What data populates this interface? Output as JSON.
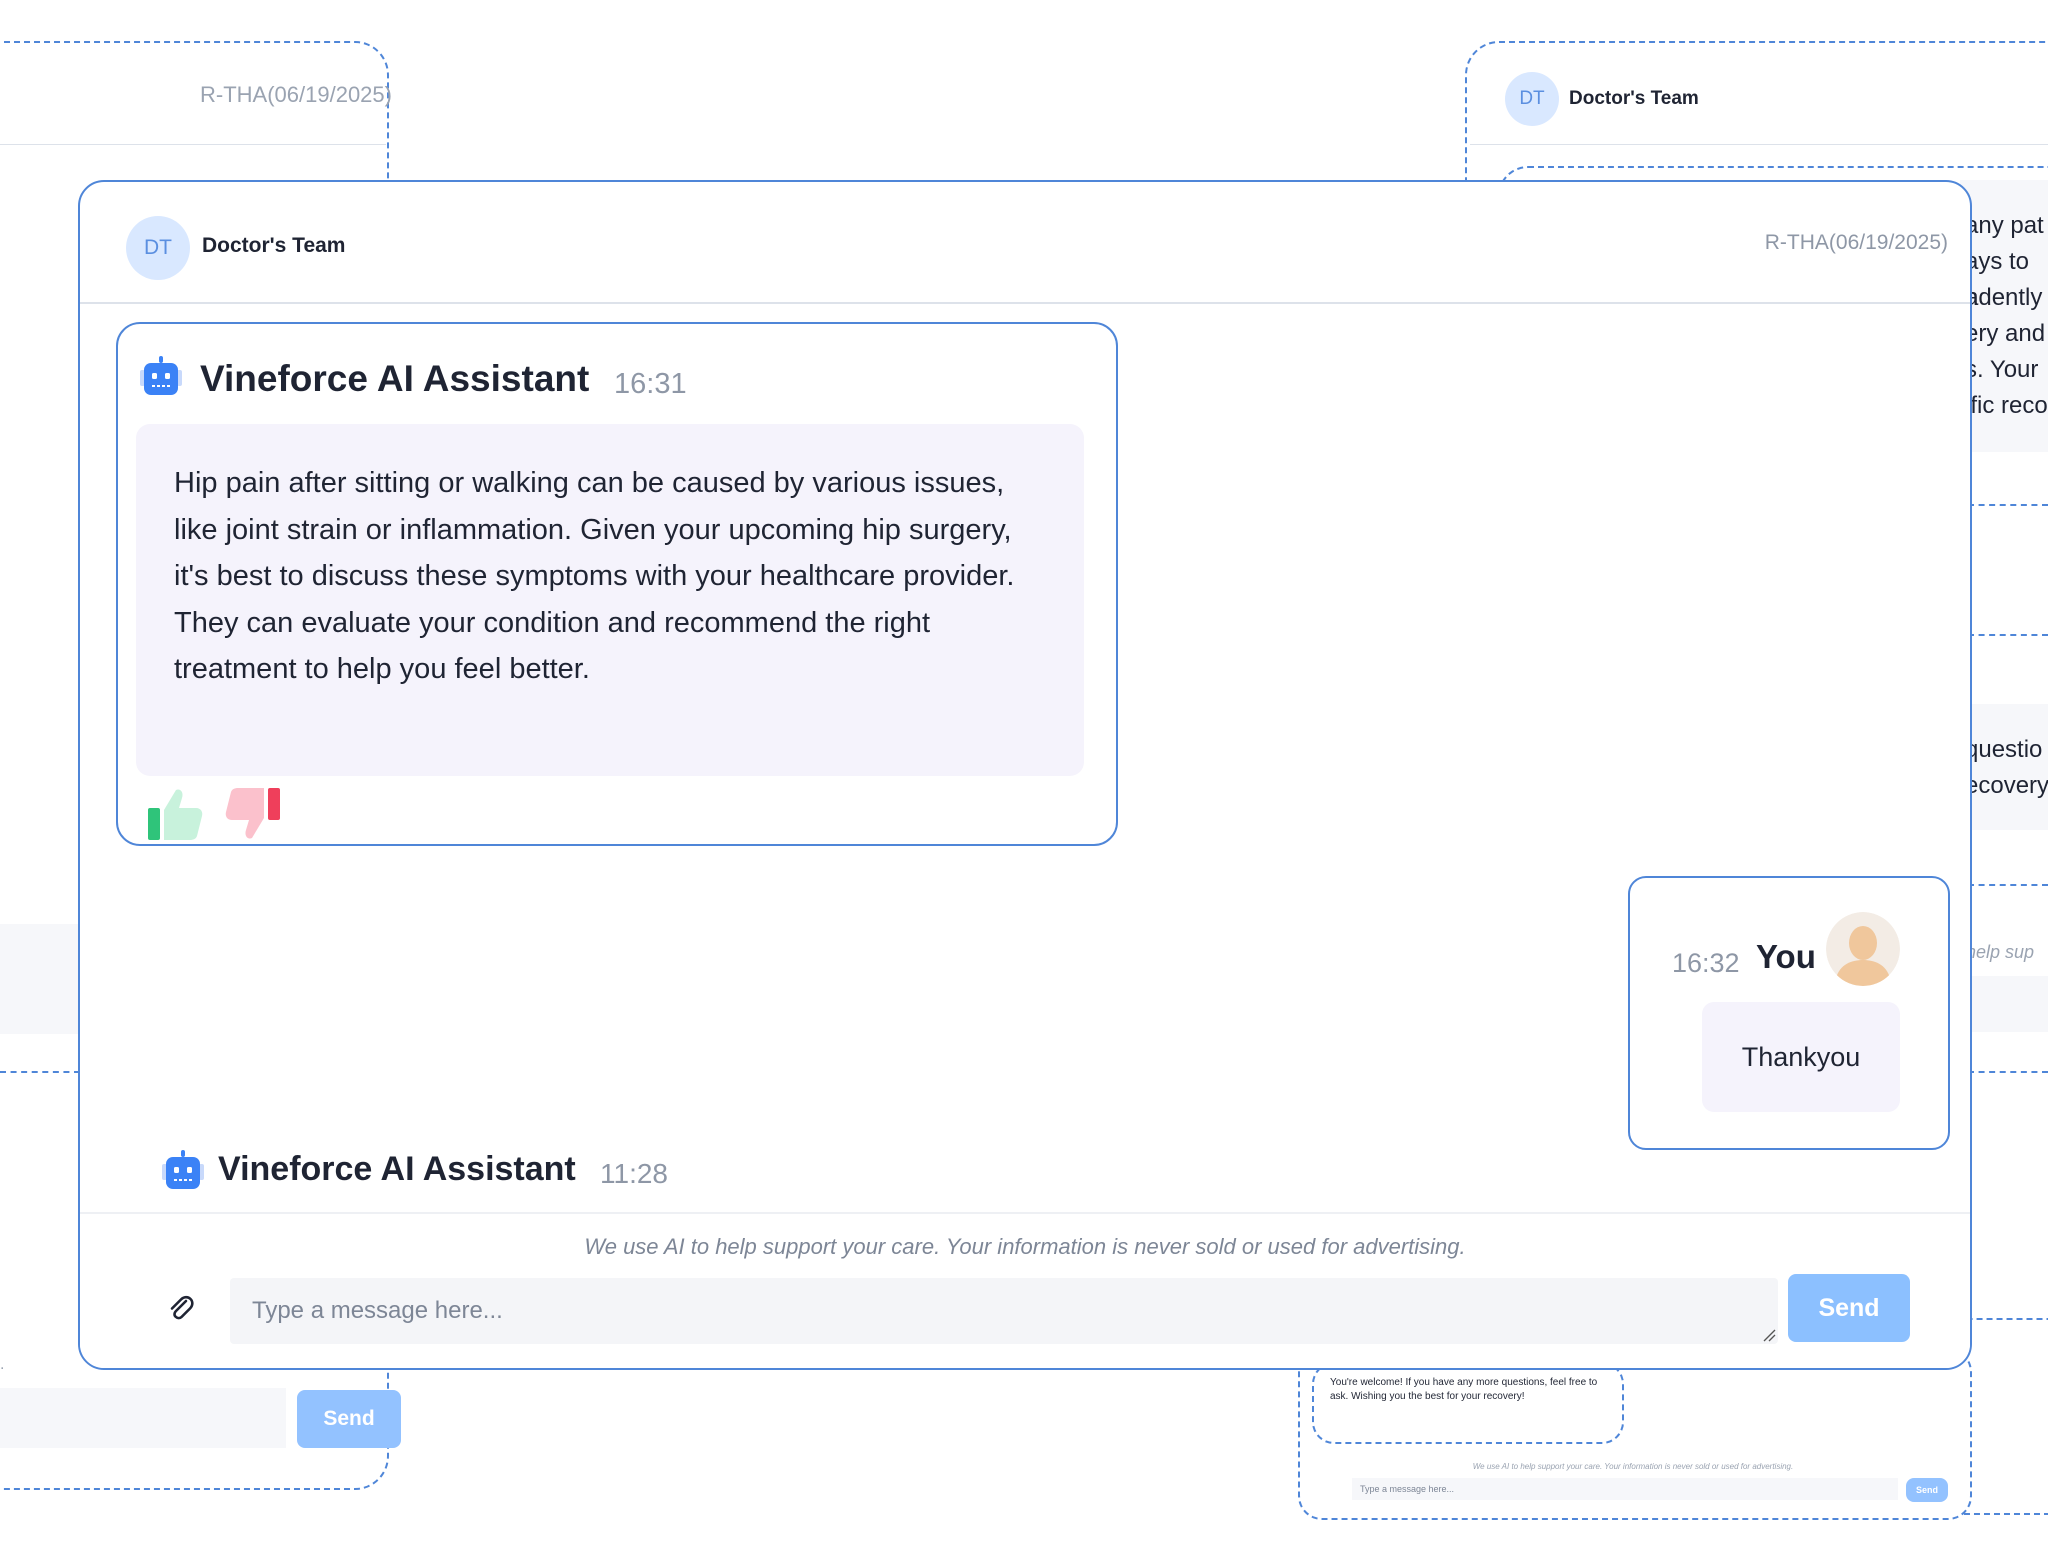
{
  "background_left": {
    "code": "R-THA(06/19/2025)",
    "period": ".",
    "send_label": "Send"
  },
  "background_right": {
    "avatar_initials": "DT",
    "team_name": "Doctor's Team",
    "snippets": [
      "any pat",
      "ays to a",
      "ndently",
      "ery and",
      "s. Your",
      "ific reco"
    ],
    "snippets_b": [
      "questio",
      "ecovery"
    ],
    "disclaimer_fragment": "help sup",
    "mini_message": "You're welcome! If you have any more questions, feel free to ask. Wishing you the best for your recovery!",
    "mini_disclaimer": "We use AI to help support your care. Your information is never sold or used for advertising.",
    "mini_placeholder": "Type a message here...",
    "mini_send_label": "Send"
  },
  "header": {
    "avatar_initials": "DT",
    "team_name": "Doctor's Team",
    "patient_code": "R-THA(06/19/2025)"
  },
  "messages": [
    {
      "sender": "Vineforce AI Assistant",
      "time": "16:31",
      "text": "Hip pain after sitting or walking can be caused by various issues, like joint strain or inflammation. Given your upcoming hip surgery, it's best to discuss these symptoms with your healthcare provider. They can evaluate your condition and recommend the right treatment to help you feel better."
    },
    {
      "sender": "You",
      "time": "16:32",
      "text": "Thankyou"
    },
    {
      "sender": "Vineforce AI Assistant",
      "time": "11:28"
    }
  ],
  "footer": {
    "disclaimer": "We use AI to help support your care. Your information is never sold or used for advertising.",
    "input_placeholder": "Type a message here...",
    "send_label": "Send"
  },
  "icons": {
    "assistant": "robot-icon",
    "like": "thumbs-up-icon",
    "dislike": "thumbs-down-icon",
    "attach": "paperclip-icon",
    "user": "user-avatar-icon"
  },
  "colors": {
    "accent": "#4f86d8",
    "send": "#8cc0ff",
    "bubble": "#f5f3fc",
    "like": "#2fc47a",
    "dislike": "#ef3f5b"
  }
}
